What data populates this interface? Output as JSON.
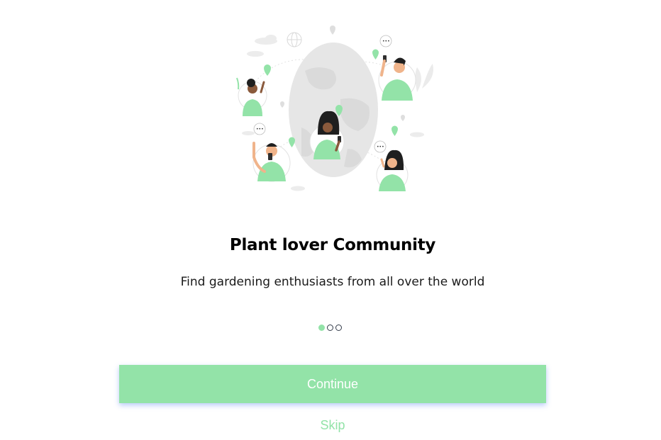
{
  "onboarding": {
    "title": "Plant lover Community",
    "subtitle": "Find gardening enthusiasts from all over the world",
    "pagination": {
      "total": 3,
      "active_index": 0
    },
    "continue_label": "Continue",
    "skip_label": "Skip"
  },
  "colors": {
    "accent": "#93e3a8",
    "text": "#000000",
    "dot_outline": "#333b4a",
    "globe": "#e6e6e6"
  },
  "illustration": {
    "icon": "community-globe-illustration"
  }
}
